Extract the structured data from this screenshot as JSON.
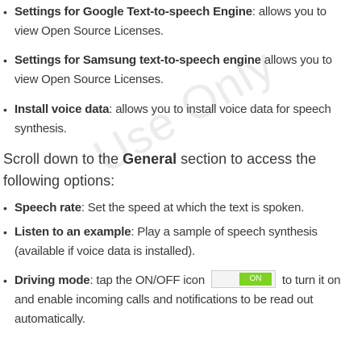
{
  "watermark": "Use Only",
  "bullets": [
    {
      "term": "Settings for Google Text-to-speech Engine",
      "text": ": allows you to view Open Source Licenses."
    },
    {
      "term": "Settings for Samsung text-to-speech engine",
      "text": " allows you to view Open Source Licenses."
    },
    {
      "term": "Install voice data",
      "text": ": allows you to install voice data for speech synthesis."
    }
  ],
  "paragraph": {
    "before": "Scroll down to the ",
    "bold": "General",
    "after": " section to access the following options:"
  },
  "options": [
    {
      "term": "Speech rate",
      "text": ": Set the speed at which the text is spoken."
    },
    {
      "term": "Listen to an example",
      "text": ": Play a sample of speech synthesis (available if voice data is installed)."
    },
    {
      "term": "Driving mode",
      "text_before": ": tap the ON/OFF icon",
      "text_after": "to turn it on and enable incoming calls and notifications to be read out automatically.",
      "toggle_label": "ON"
    }
  ],
  "bullet_char": "•",
  "colors": {
    "text": "#3a3a3a",
    "toggle_on": "#7ed321",
    "watermark": "#ececec"
  }
}
